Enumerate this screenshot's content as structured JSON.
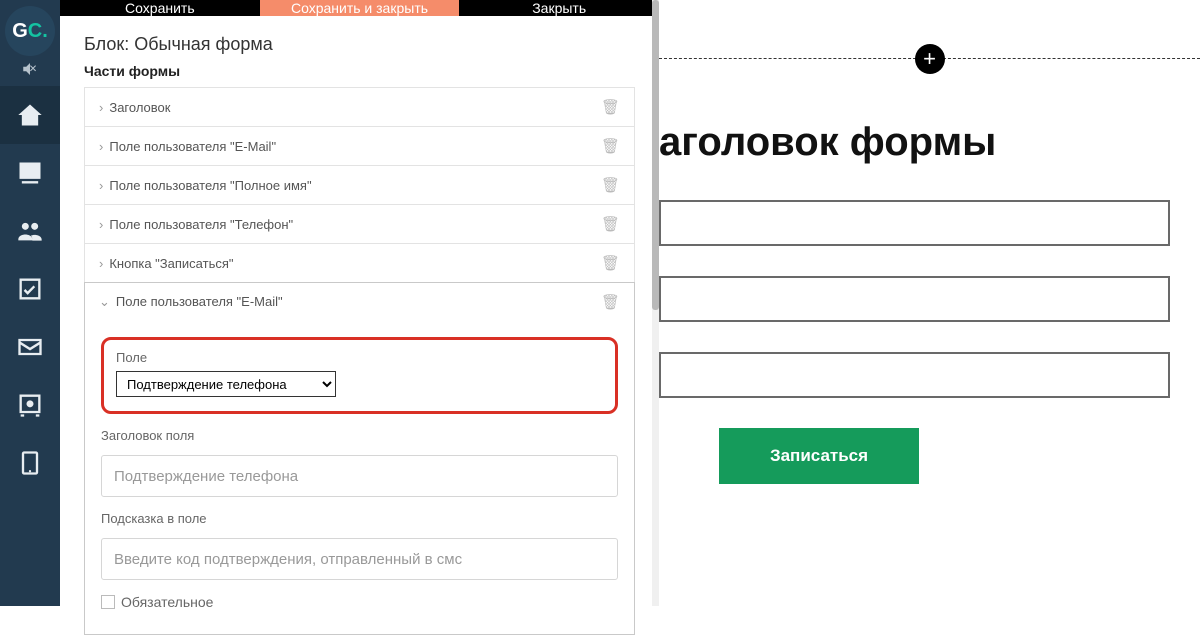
{
  "toolbar": {
    "save": "Сохранить",
    "save_close": "Сохранить и закрыть",
    "close": "Закрыть"
  },
  "block_title": "Блок: Обычная форма",
  "parts_title": "Части формы",
  "parts": [
    {
      "label": "Заголовок"
    },
    {
      "label": "Поле пользователя \"E-Mail\""
    },
    {
      "label": "Поле пользователя \"Полное имя\""
    },
    {
      "label": "Поле пользователя \"Телефон\""
    },
    {
      "label": "Кнопка \"Записаться\""
    }
  ],
  "expanded_label": "Поле пользователя \"E-Mail\"",
  "field_section": {
    "label": "Поле",
    "selected": "Подтверждение телефона",
    "title_label": "Заголовок поля",
    "title_value": "Подтверждение телефона",
    "hint_label": "Подсказка в поле",
    "hint_value": "Введите код подтверждения, отправленный в смс",
    "required_label": "Обязательное"
  },
  "preview": {
    "form_title": "аголовок формы",
    "submit": "Записаться"
  }
}
